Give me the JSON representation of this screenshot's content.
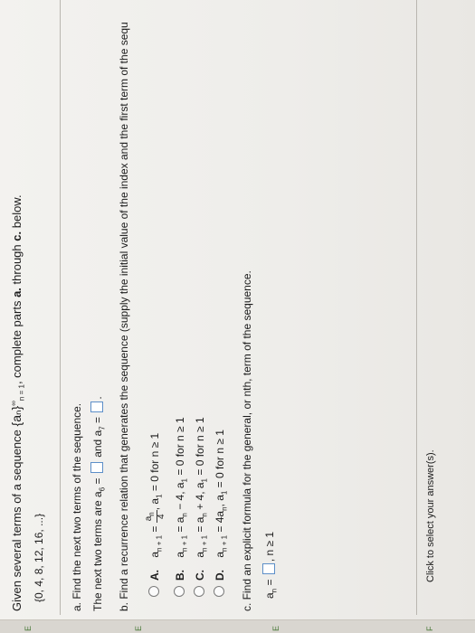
{
  "header": {
    "prefix": "Given several terms of a sequence",
    "seq": "{aₙ}",
    "bounds_sup": "∞",
    "bounds_sub": "n = 1",
    "mid": ", complete parts",
    "bold_a": "a.",
    "through": "through",
    "bold_c": "c.",
    "suffix": "below.",
    "terms": "{0, 4, 8, 12, 16, ...}"
  },
  "part_a": {
    "title": "a. Find the next two terms of the sequence.",
    "text1": "The next two terms are a",
    "sub6": "6",
    "eq": " = ",
    "and": " and a",
    "sub7": "7",
    "eq2": " = ",
    "period": "."
  },
  "part_b": {
    "title": "b. Find a recurrence relation that generates the sequence (supply the initial value of the index and the first term of the sequ",
    "options": [
      {
        "letter": "A.",
        "lhs": "a",
        "lhs_sub": "n + 1",
        "eq": " = ",
        "num": "a",
        "num_sub": "n",
        "den": "4",
        "rest": ", a",
        "rest_sub": "1",
        "tail": " = 0 for n ≥ 1"
      },
      {
        "letter": "B.",
        "text": "a",
        "sub1": "n + 1",
        "t2": " = a",
        "sub2": "n",
        "t3": " − 4, a",
        "sub3": "1",
        "t4": " = 0 for n ≥ 1"
      },
      {
        "letter": "C.",
        "text": "a",
        "sub1": "n + 1",
        "t2": " = a",
        "sub2": "n",
        "t3": " + 4, a",
        "sub3": "1",
        "t4": " = 0 for n ≥ 1"
      },
      {
        "letter": "D.",
        "text": "a",
        "sub1": "n + 1",
        "t2": " = 4a",
        "sub2": "n",
        "t3": ", a",
        "sub3": "1",
        "t4": " = 0 for n ≥ 1"
      }
    ]
  },
  "part_c": {
    "title": "c. Find an explicit formula for the general, or nth, term of the sequence.",
    "lhs": "a",
    "lhs_sub": "n",
    "eq": " = ",
    "cond": ", n ≥ 1"
  },
  "footer": {
    "hint": "Click to select your answer(s)."
  },
  "edge_labels": {
    "e1": "E",
    "e2": "E",
    "e3": "E",
    "f1": "F",
    "f2": "F",
    "i1": "i"
  }
}
